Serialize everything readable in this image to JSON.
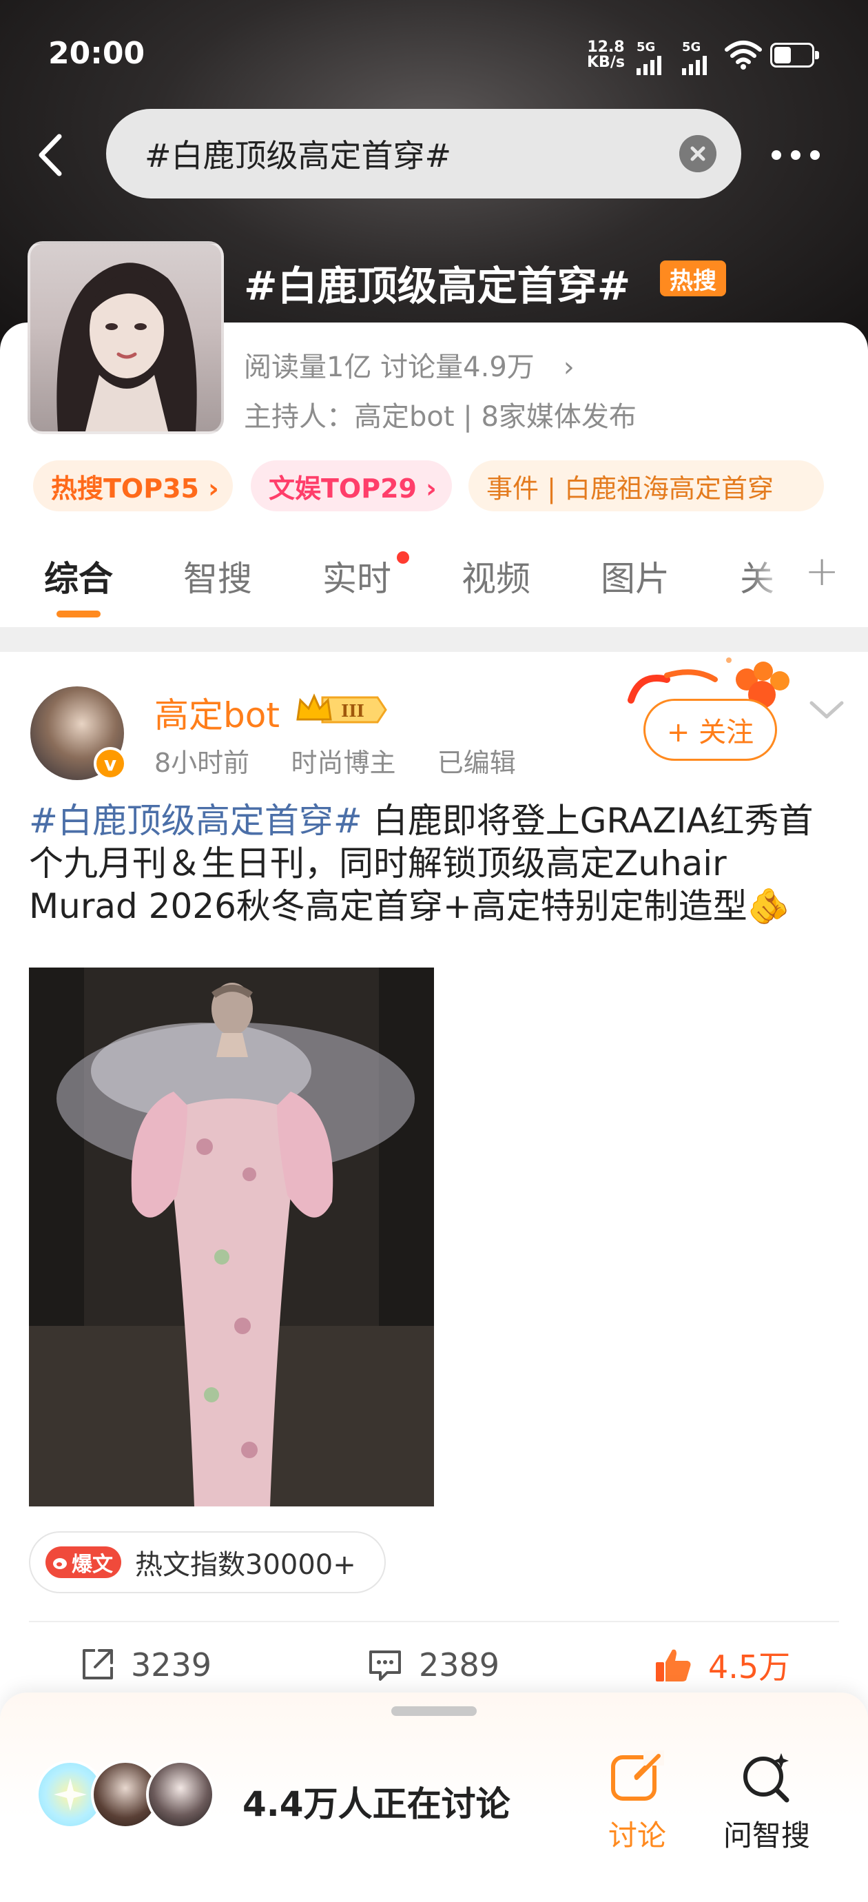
{
  "status_bar": {
    "time": "20:00",
    "net_speed_value": "12.8",
    "net_speed_unit": "KB/s",
    "signal1": "5G",
    "signal2": "5G"
  },
  "search": {
    "query": "#白鹿顶级高定首穿#"
  },
  "topic": {
    "title": "#白鹿顶级高定首穿#",
    "hot_badge": "热搜",
    "stats": "阅读量1亿  讨论量4.9万",
    "host": "主持人：高定bot | 8家媒体发布",
    "pills": [
      {
        "label": "热搜TOP35 ›"
      },
      {
        "label": "文娱TOP29 ›"
      },
      {
        "label": "事件 | 白鹿祖海高定首穿"
      }
    ]
  },
  "tabs": [
    {
      "label": "综合"
    },
    {
      "label": "智搜"
    },
    {
      "label": "实时"
    },
    {
      "label": "视频"
    },
    {
      "label": "图片"
    },
    {
      "label": "关"
    }
  ],
  "post": {
    "author": "高定bot",
    "rank_badge": "III",
    "verified_mark": "v",
    "time": "8小时前",
    "role": "时尚博主",
    "edited": "已编辑",
    "follow_label": "+ 关注",
    "hashtag": "#白鹿顶级高定首穿#",
    "body": " 白鹿即将登上GRAZIA红秀首个九月刊＆生日刊，同时解锁顶级高定Zuhair Murad 2026秋冬高定首穿+高定特别定制造型",
    "emoji": "🫵",
    "hot_badge": "爆文",
    "hot_index": "热文指数30000+",
    "reposts": "3239",
    "comments": "2389",
    "likes": "4.5万"
  },
  "bottom_bar": {
    "discussing": "4.4万人正在讨论",
    "discuss_label": "讨论",
    "ask_label": "问智搜"
  },
  "colors": {
    "accent": "#ff8a1f",
    "hashtag": "#4b6fa8",
    "like": "#ff5a1f"
  }
}
